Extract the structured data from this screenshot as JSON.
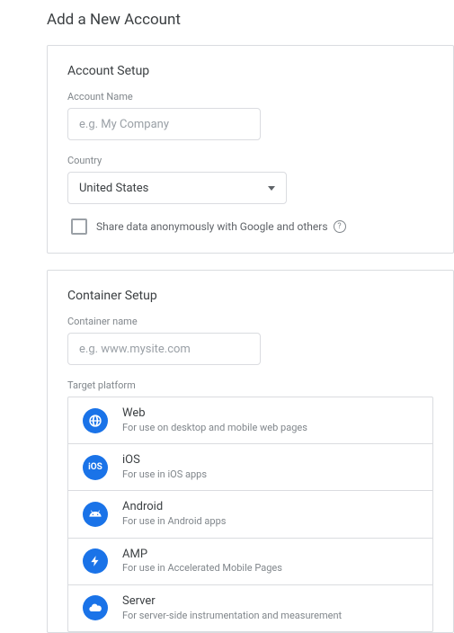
{
  "page_title": "Add a New Account",
  "account_setup": {
    "title": "Account Setup",
    "name_label": "Account Name",
    "name_placeholder": "e.g. My Company",
    "country_label": "Country",
    "country_value": "United States",
    "share_checkbox_label": "Share data anonymously with Google and others"
  },
  "container_setup": {
    "title": "Container Setup",
    "name_label": "Container name",
    "name_placeholder": "e.g. www.mysite.com",
    "target_label": "Target platform",
    "platforms": [
      {
        "name": "Web",
        "desc": "For use on desktop and mobile web pages"
      },
      {
        "name": "iOS",
        "desc": "For use in iOS apps"
      },
      {
        "name": "Android",
        "desc": "For use in Android apps"
      },
      {
        "name": "AMP",
        "desc": "For use in Accelerated Mobile Pages"
      },
      {
        "name": "Server",
        "desc": "For server-side instrumentation and measurement"
      }
    ]
  }
}
